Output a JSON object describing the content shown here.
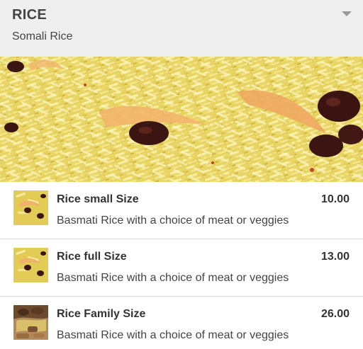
{
  "category": {
    "title": "RICE",
    "subtitle": "Somali Rice",
    "toggle_icon": "caret-down-icon"
  },
  "hero": {
    "image": "rice-dish-photo"
  },
  "items": [
    {
      "name": "Rice small Size",
      "price": "10.00",
      "description": "Basmati Rice with a choice of meat or veggies",
      "thumb": "rice-thumbnail"
    },
    {
      "name": "Rice full Size",
      "price": "13.00",
      "description": "Basmati Rice with a choice of meat or veggies",
      "thumb": "rice-thumbnail"
    },
    {
      "name": "Rice Family Size",
      "price": "26.00",
      "description": "Basmati Rice with a choice of meat or veggies",
      "thumb": "rice-meat-thumbnail"
    }
  ]
}
